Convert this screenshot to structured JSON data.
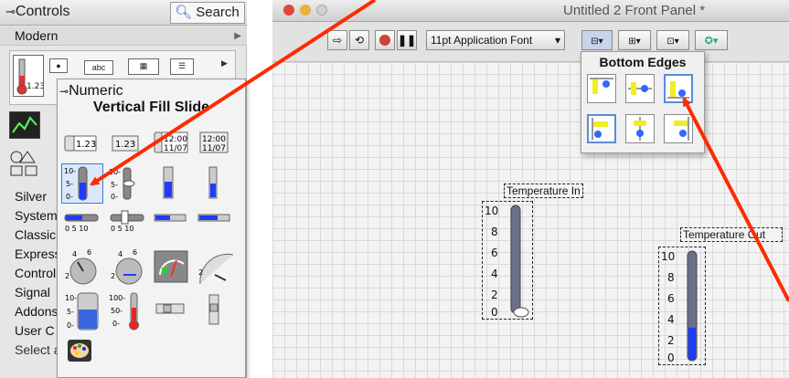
{
  "palette": {
    "title": "Controls",
    "search_label": "Search",
    "category_open": "Modern",
    "categories": [
      "Silver",
      "System",
      "Classic",
      "Express",
      "Controls",
      "Signal",
      "Addons",
      "User C",
      "Select a Control..."
    ],
    "numeric": {
      "title": "Numeric",
      "hover_label": "Vertical Fill Slide"
    }
  },
  "front_panel": {
    "title": "Untitled 2 Front Panel *",
    "font_button": "11pt Application Font",
    "align_popup": {
      "title": "Bottom Edges"
    },
    "indicators": [
      {
        "label": "Temperature In",
        "ticks": [
          "10",
          "8",
          "6",
          "4",
          "2",
          "0"
        ],
        "value": 0,
        "min": 0,
        "max": 10
      },
      {
        "label": "Temperature Out",
        "ticks": [
          "10",
          "8",
          "6",
          "4",
          "2",
          "0"
        ],
        "value": 3,
        "min": 0,
        "max": 10
      }
    ]
  },
  "colors": {
    "arrow": "#ff2a00",
    "fill_blue": "#1d3cff",
    "selection": "#3a7bd5"
  }
}
